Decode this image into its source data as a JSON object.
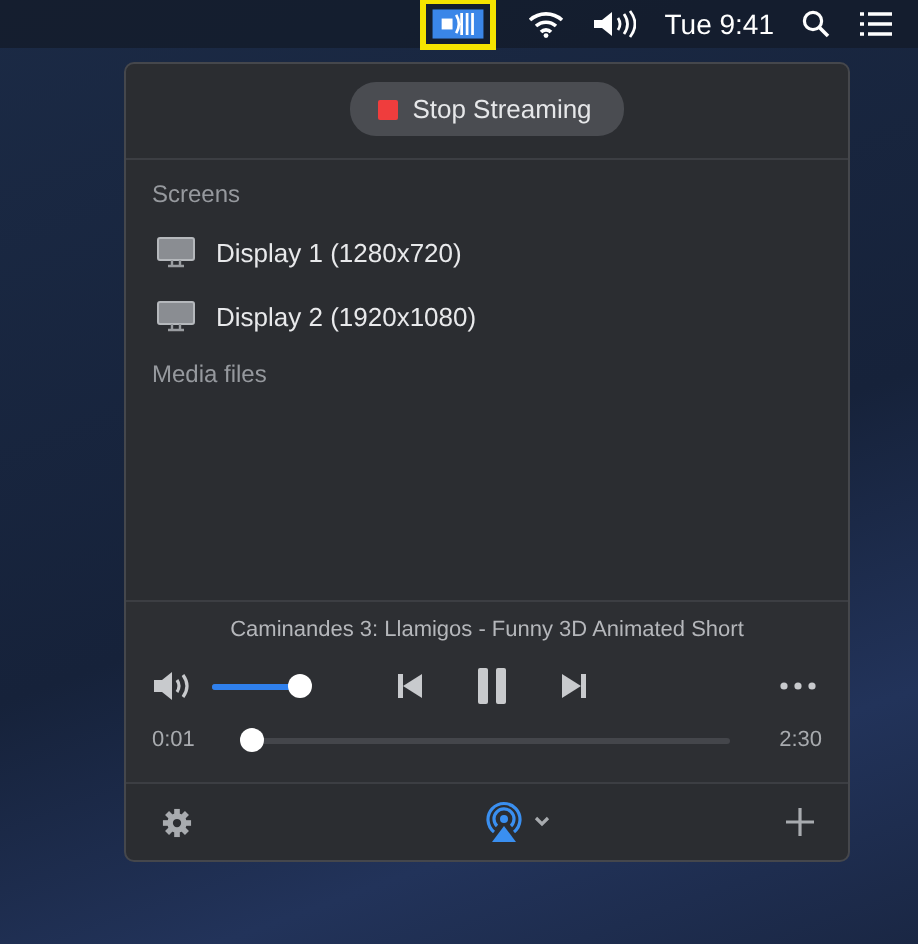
{
  "menu_bar": {
    "clock": "Tue 9:41",
    "app_icon_highlighted": true
  },
  "stop_button": {
    "label": "Stop Streaming"
  },
  "sections": [
    {
      "title": "Screens",
      "items": [
        {
          "label": "Display 1 (1280x720)"
        },
        {
          "label": "Display 2 (1920x1080)"
        }
      ]
    },
    {
      "title": "Media files"
    }
  ],
  "player": {
    "title": "Caminandes 3: Llamigos - Funny 3D Animated Short",
    "volume": {
      "level": 1.0
    },
    "playing": true,
    "elapsed": "0:01",
    "duration": "2:30",
    "progress": {
      "level": 0.0
    }
  }
}
